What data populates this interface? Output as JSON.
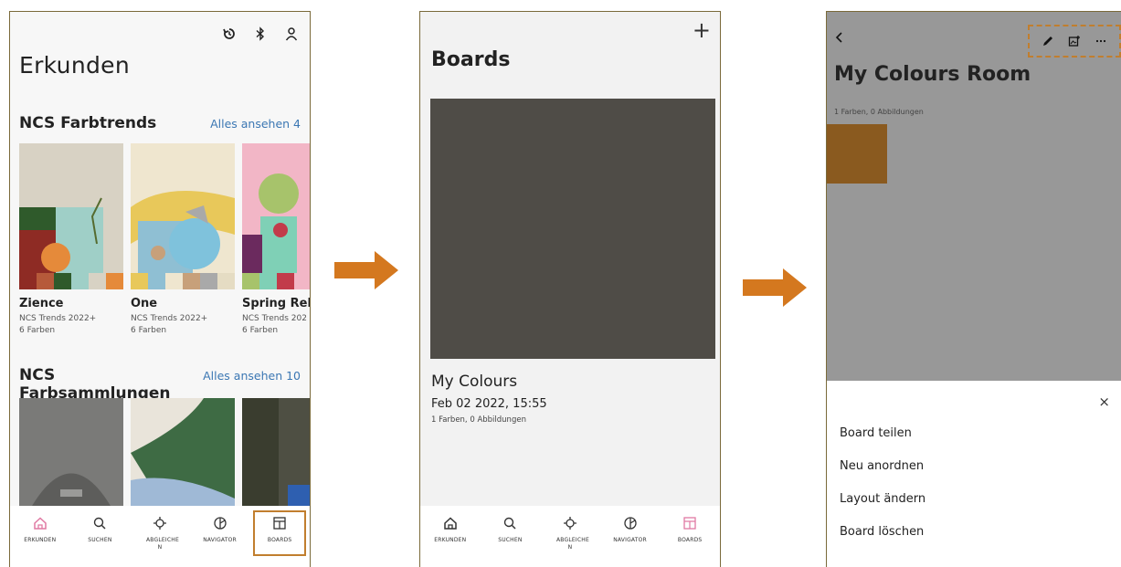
{
  "screen1": {
    "title": "Erkunden",
    "section1": {
      "title": "NCS Farbtrends",
      "link": "Alles ansehen 4"
    },
    "cards": [
      {
        "name": "Zience",
        "sub": "NCS Trends 2022+",
        "count": "6 Farben"
      },
      {
        "name": "One",
        "sub": "NCS Trends 2022+",
        "count": "6 Farben"
      },
      {
        "name": "Spring Rebe",
        "sub": "NCS Trends 202",
        "count": "6 Farben"
      }
    ],
    "section2": {
      "title": "NCS Farbsammlungen",
      "link": "Alles ansehen 10"
    }
  },
  "nav": {
    "items": [
      "ERKUNDEN",
      "SUCHEN",
      "ABGLEICHE N",
      "NAVIGATOR",
      "BOARDS"
    ]
  },
  "screen2": {
    "title": "Boards",
    "add_icon": "+",
    "board_name": "My Colours",
    "board_date": "Feb 02 2022, 15:55",
    "board_meta": "1 Farben, 0 Abbildungen"
  },
  "screen3": {
    "title": "My Colours Room",
    "meta": "1 Farben, 0 Abbildungen",
    "close_icon": "×",
    "menu": [
      "Board teilen",
      "Neu anordnen",
      "Layout ändern",
      "Board löschen"
    ]
  },
  "colors": {
    "accent": "#c17e2e",
    "link": "#3b77b3",
    "board_swatch": "#4f4c47",
    "room_swatch": "#8a5a1f",
    "nav_active": "#e07aa3"
  },
  "icons": [
    "history-icon",
    "bluetooth-icon",
    "user-icon",
    "home-icon",
    "search-icon",
    "crosshair-icon",
    "navigator-icon",
    "boards-icon",
    "plus-icon",
    "back-icon",
    "pencil-icon",
    "add-image-icon",
    "more-icon",
    "close-icon",
    "arrow-right-icon"
  ]
}
